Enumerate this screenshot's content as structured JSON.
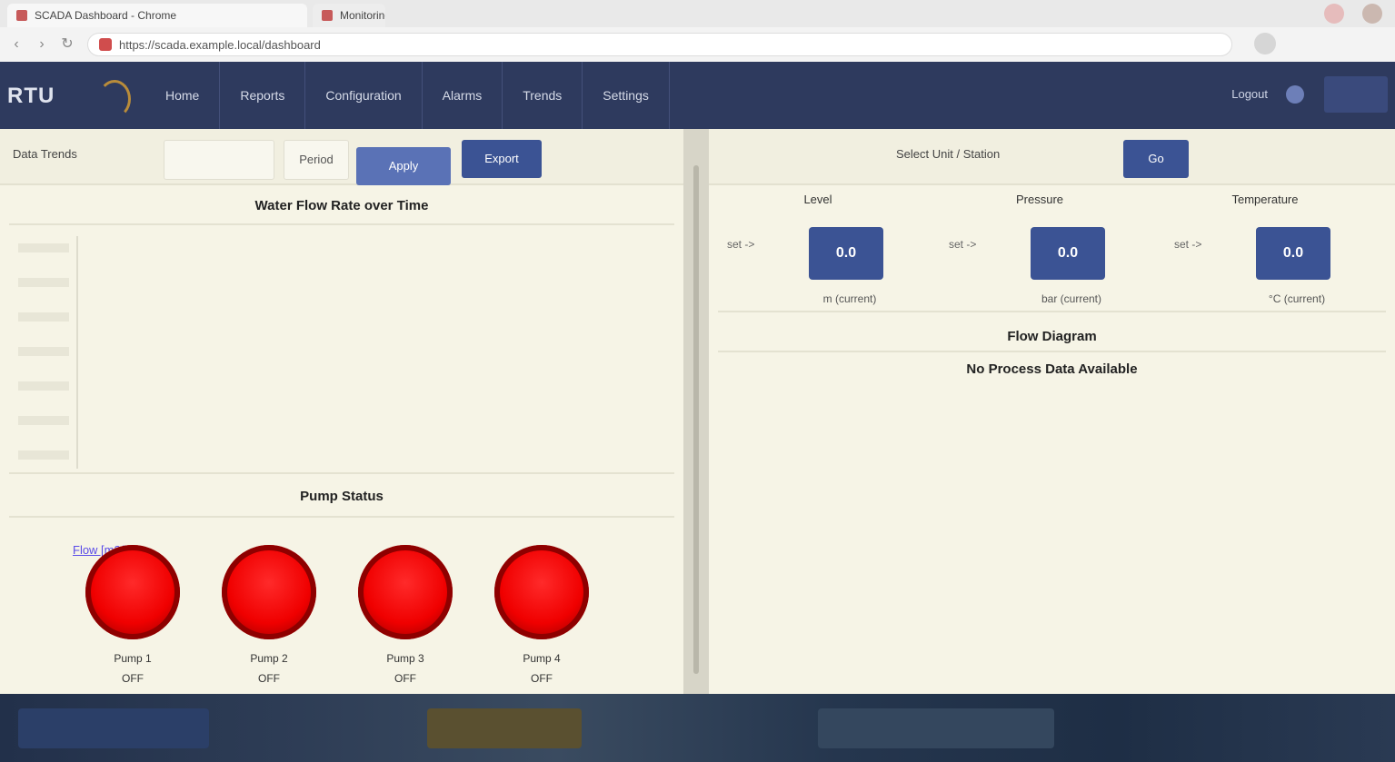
{
  "browser": {
    "tabs": [
      {
        "title": "SCADA Dashboard - Chrome"
      },
      {
        "title": "Monitoring"
      }
    ],
    "url": "https://scada.example.local/dashboard"
  },
  "app": {
    "logo": "RTU",
    "menu": [
      "Home",
      "Reports",
      "Configuration",
      "Alarms",
      "Trends",
      "Settings"
    ],
    "user": "Logout"
  },
  "left": {
    "toolbar_label": "Data Trends",
    "buttons": [
      "Period",
      "Apply",
      "Export"
    ],
    "chart_title": "Water Flow Rate over Time",
    "legend": "Flow [m3/h]",
    "status_title": "Pump Status",
    "pumps": [
      {
        "name": "Pump 1",
        "state": "OFF"
      },
      {
        "name": "Pump 2",
        "state": "OFF"
      },
      {
        "name": "Pump 3",
        "state": "OFF"
      },
      {
        "name": "Pump 4",
        "state": "OFF"
      }
    ]
  },
  "right": {
    "toolbar_label": "Select Unit / Station",
    "toolbar_button": "Go",
    "dials": [
      {
        "caption": "Level",
        "arrow": "set ->",
        "value": "0.0",
        "footer": "m (current)"
      },
      {
        "caption": "Pressure",
        "arrow": "set ->",
        "value": "0.0",
        "footer": "bar (current)"
      },
      {
        "caption": "Temperature",
        "arrow": "set ->",
        "value": "0.0",
        "footer": "°C (current)"
      }
    ],
    "section_title_1": "Flow Diagram",
    "section_title_2": "No Process Data Available"
  },
  "colors": {
    "nav": "#2e3a5e",
    "accent": "#3b5394",
    "pane": "#f6f4e6",
    "alarm_red": "#f00000"
  },
  "icons": {
    "back": "arrow-left-icon",
    "forward": "arrow-right-icon",
    "reload": "reload-icon",
    "lock": "lock-icon",
    "user": "user-icon"
  }
}
